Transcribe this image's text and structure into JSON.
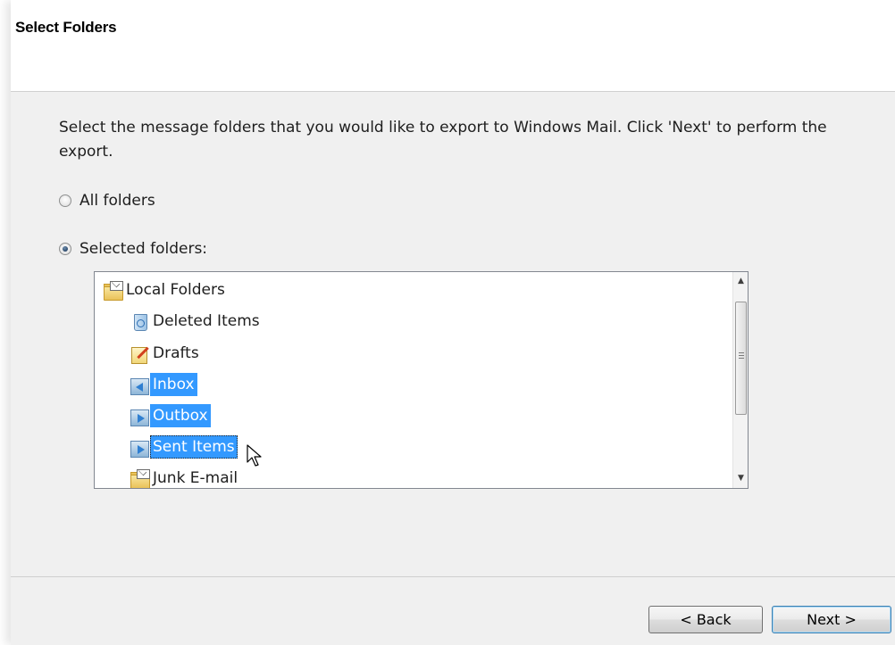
{
  "header": {
    "title": "Select Folders"
  },
  "instruction": "Select the message folders that you would like to export to Windows Mail. Click 'Next' to perform the export.",
  "options": {
    "all_folders": "All folders",
    "selected_folders": "Selected folders:",
    "selected": "selected_folders"
  },
  "tree": {
    "items": [
      {
        "label": "Local Folders",
        "icon": "mail-folder-icon",
        "selected": false
      },
      {
        "label": "Deleted Items",
        "icon": "recycle-bin-icon",
        "selected": false
      },
      {
        "label": "Drafts",
        "icon": "drafts-icon",
        "selected": false
      },
      {
        "label": "Inbox",
        "icon": "inbox-icon",
        "selected": true
      },
      {
        "label": "Outbox",
        "icon": "outbox-icon",
        "selected": true
      },
      {
        "label": "Sent Items",
        "icon": "sent-items-icon",
        "selected": true
      },
      {
        "label": "Junk E-mail",
        "icon": "mail-folder-icon",
        "selected": false
      }
    ]
  },
  "buttons": {
    "back": "< Back",
    "next": "Next >"
  },
  "colors": {
    "selection": "#3399ff",
    "background": "#f0f0f0"
  }
}
